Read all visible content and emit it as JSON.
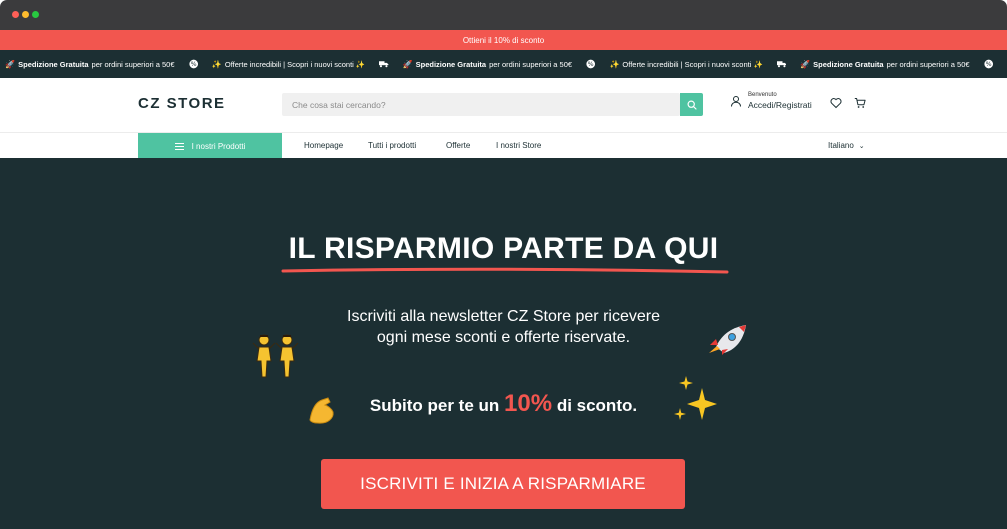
{
  "promo": {
    "text": "Ottieni il 10% di sconto"
  },
  "ticker": {
    "items": [
      {
        "icon": "rocket-icon",
        "bold": "Spedizione Gratuita",
        "text": "per ordini superiori a 50€"
      },
      {
        "icon": "percent-badge-icon"
      },
      {
        "icon": "sparkles-icon",
        "text": "Offerte incredibili | Scopri i nuovi sconti ✨"
      },
      {
        "icon": "truck-icon"
      },
      {
        "icon": "rocket-icon",
        "bold": "Spedizione Gratuita",
        "text": "per ordini superiori a 50€"
      },
      {
        "icon": "percent-badge-icon"
      },
      {
        "icon": "sparkles-icon",
        "text": "Offerte incredibili | Scopri i nuovi sconti ✨"
      },
      {
        "icon": "truck-icon"
      },
      {
        "icon": "rocket-icon",
        "bold": "Spedizione Gratuita",
        "text": "per ordini superiori a 50€"
      },
      {
        "icon": "percent-badge-icon"
      }
    ]
  },
  "header": {
    "logo": "CZ STORE",
    "search_placeholder": "Che cosa stai cercando?",
    "account_small": "Benvenuto",
    "account_label": "Accedi/Registrati"
  },
  "nav": {
    "products_label": "I nostri Prodotti",
    "links": [
      "Homepage",
      "Tutti i prodotti",
      "Offerte",
      "I nostri Store"
    ],
    "language": "Italiano"
  },
  "hero": {
    "title": "IL RISPARMIO PARTE DA QUI",
    "text_line1": "Iscriviti alla newsletter CZ Store per ricevere",
    "text_line2": "ogni mese sconti e offerte riservate.",
    "discount_prefix": "Subito per te un",
    "discount_value": "10%",
    "discount_suffix": "di sconto.",
    "cta_label": "ISCRIVITI E INIZIA A RISPARMIARE"
  },
  "colors": {
    "accent_red": "#f2564f",
    "accent_green": "#4fc3a1",
    "dark_bg": "#1c2f33"
  }
}
